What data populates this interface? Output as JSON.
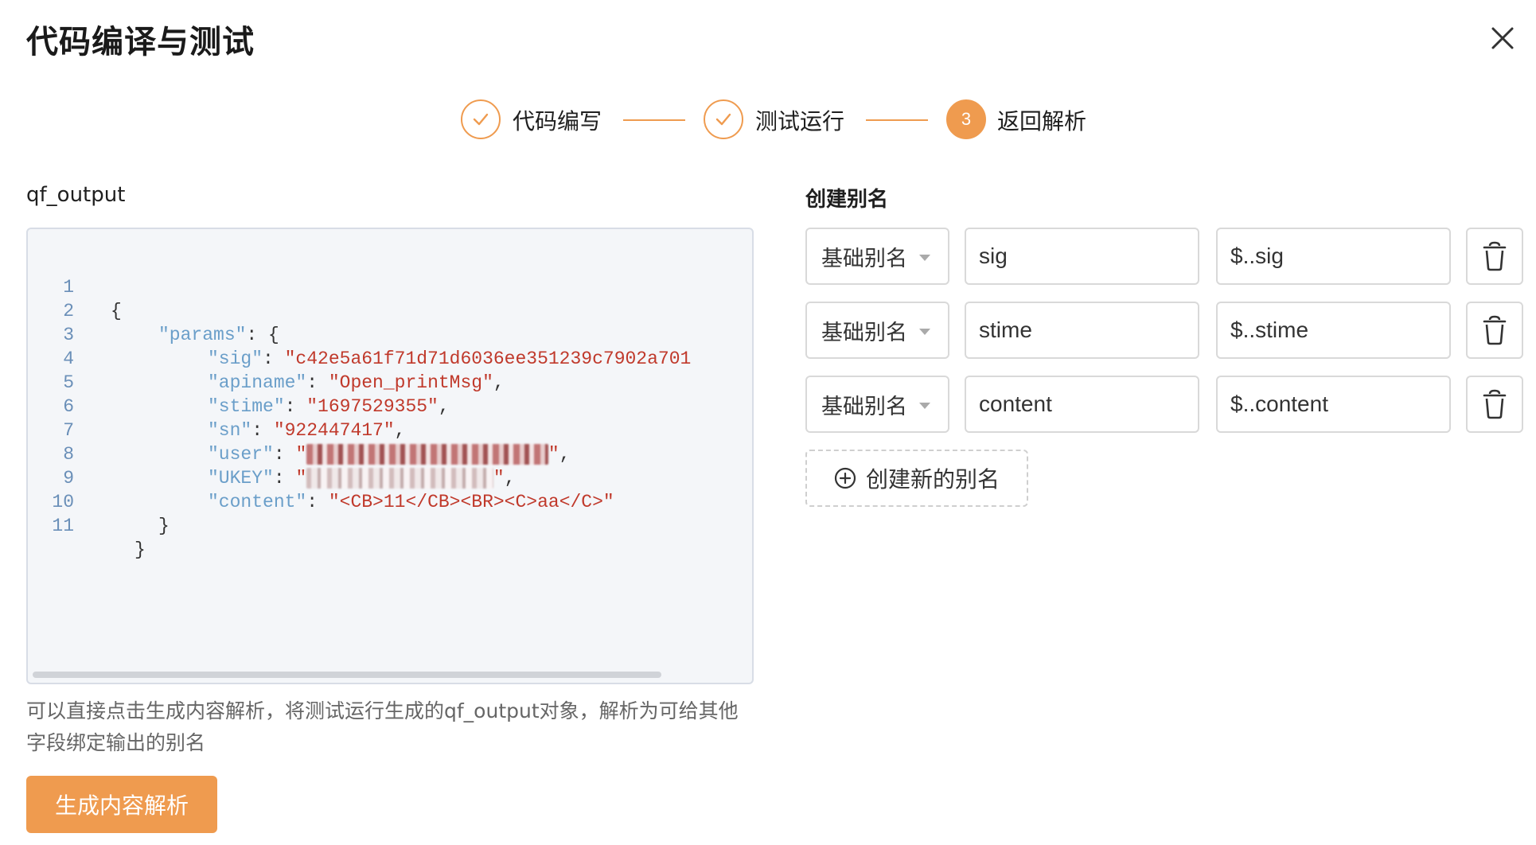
{
  "dialog": {
    "title": "代码编译与测试"
  },
  "steps": [
    {
      "label": "代码编写",
      "status": "done"
    },
    {
      "label": "测试运行",
      "status": "done"
    },
    {
      "label": "返回解析",
      "status": "active",
      "number": "3"
    }
  ],
  "output": {
    "label": "qf_output",
    "lines": [
      {
        "n": "1",
        "text": "{"
      },
      {
        "n": "2",
        "key": "\"params\"",
        "rest": ": {"
      },
      {
        "n": "3",
        "key": "\"sig\"",
        "sep": ": ",
        "val": "\"c42e5a61f71d71d6036ee351239c7902a701"
      },
      {
        "n": "4",
        "key": "\"apiname\"",
        "sep": ": ",
        "val": "\"Open_printMsg\"",
        "tail": ","
      },
      {
        "n": "5",
        "key": "\"stime\"",
        "sep": ": ",
        "val": "\"1697529355\"",
        "tail": ","
      },
      {
        "n": "6",
        "key": "\"sn\"",
        "sep": ": ",
        "val": "\"922447417\"",
        "tail": ","
      },
      {
        "n": "7",
        "key": "\"user\"",
        "sep": ": ",
        "val": "\"",
        "val_end": "\"",
        "tail": ","
      },
      {
        "n": "8",
        "key": "\"UKEY\"",
        "sep": ": ",
        "val": "\"",
        "val_end": "\"",
        "tail": ","
      },
      {
        "n": "9",
        "key": "\"content\"",
        "sep": ": ",
        "val": "\"<CB>11</CB><BR><C>aa</C>\""
      },
      {
        "n": "10",
        "text": "}"
      },
      {
        "n": "11",
        "text": "}"
      }
    ],
    "hint": "可以直接点击生成内容解析，将测试运行生成的qf_output对象，解析为可给其他字段绑定输出的别名",
    "generate_button": "生成内容解析"
  },
  "aliases": {
    "title": "创建别名",
    "rows": [
      {
        "type": "基础别名",
        "name": "sig",
        "path": "$..sig"
      },
      {
        "type": "基础别名",
        "name": "stime",
        "path": "$..stime"
      },
      {
        "type": "基础别名",
        "name": "content",
        "path": "$..content"
      }
    ],
    "add_button": "创建新的别名"
  },
  "colors": {
    "accent": "#ef9b4f",
    "key": "#6a9ec9",
    "string": "#c0392b"
  }
}
